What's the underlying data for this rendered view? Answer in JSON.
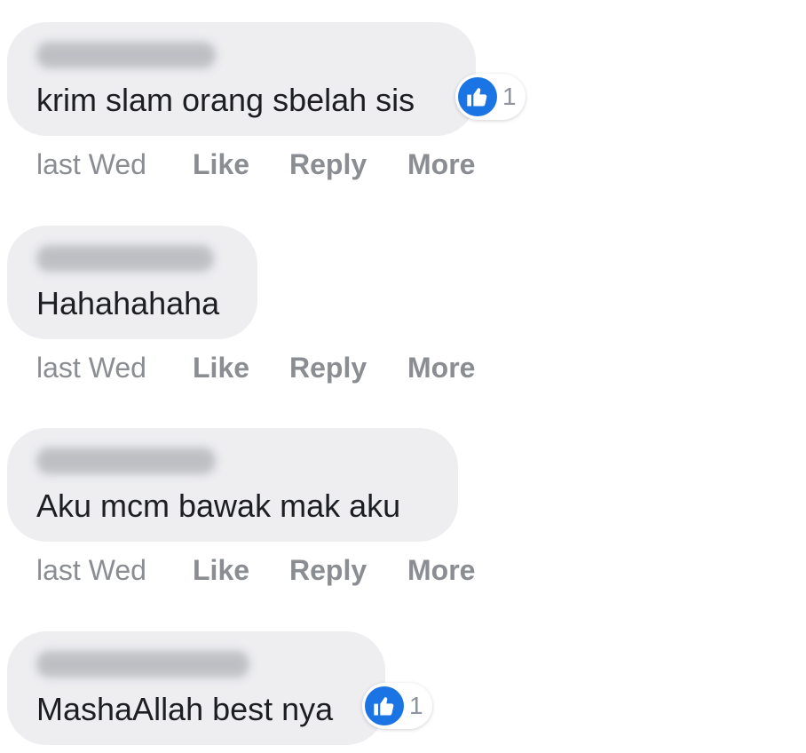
{
  "comments": [
    {
      "text": "krim slam orang sbelah sis",
      "time": "last Wed",
      "like_label": "Like",
      "reply_label": "Reply",
      "more_label": "More",
      "reaction_count": "1"
    },
    {
      "text": "Hahahahaha",
      "time": "last Wed",
      "like_label": "Like",
      "reply_label": "Reply",
      "more_label": "More"
    },
    {
      "text": "Aku mcm bawak mak aku",
      "time": "last Wed",
      "like_label": "Like",
      "reply_label": "Reply",
      "more_label": "More"
    },
    {
      "text": "MashaAllah best nya",
      "reaction_count": "1"
    }
  ],
  "icons": {
    "reaction": "thumbs-up-icon"
  },
  "colors": {
    "bubble": "#eeeef1",
    "reaction_blue": "#1b74e4",
    "meta_text": "#8a8d91"
  }
}
